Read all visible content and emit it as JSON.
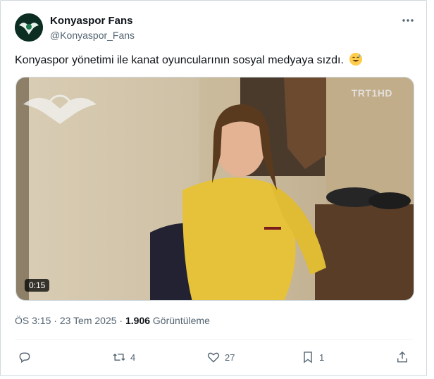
{
  "tweet": {
    "author_name": "Konyaspor Fans",
    "author_handle": "@Konyaspor_Fans",
    "text": "Konyaspor yönetimi ile kanat oyuncularının sosyal medyaya sızdı.",
    "emoji": "sweat-smile-emoji",
    "video": {
      "duration": "0:15",
      "channel_logo": "TRT1HD"
    },
    "time": "ÖS 3:15",
    "separator1": "·",
    "date": "23 Tem 2025",
    "separator2": "·",
    "views_count": "1.906",
    "views_label": "Görüntüleme"
  },
  "actions": {
    "reply_count": "",
    "retweet_count": "4",
    "like_count": "27",
    "bookmark_count": "1"
  },
  "icons": [
    "more-icon",
    "reply-icon",
    "retweet-icon",
    "like-icon",
    "bookmark-icon",
    "share-icon"
  ],
  "colors": {
    "text": "#0f1419",
    "secondary": "#536471",
    "border": "#cfd9de",
    "avatar_bg": "#0c2e22",
    "shirt": "#e6c23a"
  }
}
